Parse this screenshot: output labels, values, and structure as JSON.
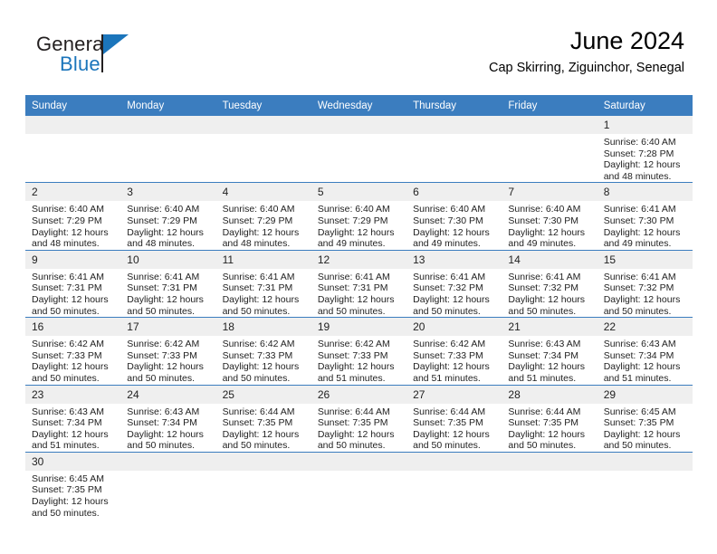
{
  "brand": {
    "name_part1": "General",
    "name_part2": "Blue",
    "flag_icon": "triangle-flag-icon"
  },
  "header": {
    "title": "June 2024",
    "subtitle": "Cap Skirring, Ziguinchor, Senegal"
  },
  "colors": {
    "header_bar": "#3b7dbf",
    "day_band": "#efefef",
    "brand_blue": "#1b75bb",
    "row_divider": "#3b7dbf"
  },
  "weekdays": [
    "Sunday",
    "Monday",
    "Tuesday",
    "Wednesday",
    "Thursday",
    "Friday",
    "Saturday"
  ],
  "weeks": [
    [
      {
        "day": "",
        "blank": true
      },
      {
        "day": "",
        "blank": true
      },
      {
        "day": "",
        "blank": true
      },
      {
        "day": "",
        "blank": true
      },
      {
        "day": "",
        "blank": true
      },
      {
        "day": "",
        "blank": true
      },
      {
        "day": "1",
        "sunrise": "Sunrise: 6:40 AM",
        "sunset": "Sunset: 7:28 PM",
        "daylight_line1": "Daylight: 12 hours",
        "daylight_line2": "and 48 minutes."
      }
    ],
    [
      {
        "day": "2",
        "sunrise": "Sunrise: 6:40 AM",
        "sunset": "Sunset: 7:29 PM",
        "daylight_line1": "Daylight: 12 hours",
        "daylight_line2": "and 48 minutes."
      },
      {
        "day": "3",
        "sunrise": "Sunrise: 6:40 AM",
        "sunset": "Sunset: 7:29 PM",
        "daylight_line1": "Daylight: 12 hours",
        "daylight_line2": "and 48 minutes."
      },
      {
        "day": "4",
        "sunrise": "Sunrise: 6:40 AM",
        "sunset": "Sunset: 7:29 PM",
        "daylight_line1": "Daylight: 12 hours",
        "daylight_line2": "and 48 minutes."
      },
      {
        "day": "5",
        "sunrise": "Sunrise: 6:40 AM",
        "sunset": "Sunset: 7:29 PM",
        "daylight_line1": "Daylight: 12 hours",
        "daylight_line2": "and 49 minutes."
      },
      {
        "day": "6",
        "sunrise": "Sunrise: 6:40 AM",
        "sunset": "Sunset: 7:30 PM",
        "daylight_line1": "Daylight: 12 hours",
        "daylight_line2": "and 49 minutes."
      },
      {
        "day": "7",
        "sunrise": "Sunrise: 6:40 AM",
        "sunset": "Sunset: 7:30 PM",
        "daylight_line1": "Daylight: 12 hours",
        "daylight_line2": "and 49 minutes."
      },
      {
        "day": "8",
        "sunrise": "Sunrise: 6:41 AM",
        "sunset": "Sunset: 7:30 PM",
        "daylight_line1": "Daylight: 12 hours",
        "daylight_line2": "and 49 minutes."
      }
    ],
    [
      {
        "day": "9",
        "sunrise": "Sunrise: 6:41 AM",
        "sunset": "Sunset: 7:31 PM",
        "daylight_line1": "Daylight: 12 hours",
        "daylight_line2": "and 50 minutes."
      },
      {
        "day": "10",
        "sunrise": "Sunrise: 6:41 AM",
        "sunset": "Sunset: 7:31 PM",
        "daylight_line1": "Daylight: 12 hours",
        "daylight_line2": "and 50 minutes."
      },
      {
        "day": "11",
        "sunrise": "Sunrise: 6:41 AM",
        "sunset": "Sunset: 7:31 PM",
        "daylight_line1": "Daylight: 12 hours",
        "daylight_line2": "and 50 minutes."
      },
      {
        "day": "12",
        "sunrise": "Sunrise: 6:41 AM",
        "sunset": "Sunset: 7:31 PM",
        "daylight_line1": "Daylight: 12 hours",
        "daylight_line2": "and 50 minutes."
      },
      {
        "day": "13",
        "sunrise": "Sunrise: 6:41 AM",
        "sunset": "Sunset: 7:32 PM",
        "daylight_line1": "Daylight: 12 hours",
        "daylight_line2": "and 50 minutes."
      },
      {
        "day": "14",
        "sunrise": "Sunrise: 6:41 AM",
        "sunset": "Sunset: 7:32 PM",
        "daylight_line1": "Daylight: 12 hours",
        "daylight_line2": "and 50 minutes."
      },
      {
        "day": "15",
        "sunrise": "Sunrise: 6:41 AM",
        "sunset": "Sunset: 7:32 PM",
        "daylight_line1": "Daylight: 12 hours",
        "daylight_line2": "and 50 minutes."
      }
    ],
    [
      {
        "day": "16",
        "sunrise": "Sunrise: 6:42 AM",
        "sunset": "Sunset: 7:33 PM",
        "daylight_line1": "Daylight: 12 hours",
        "daylight_line2": "and 50 minutes."
      },
      {
        "day": "17",
        "sunrise": "Sunrise: 6:42 AM",
        "sunset": "Sunset: 7:33 PM",
        "daylight_line1": "Daylight: 12 hours",
        "daylight_line2": "and 50 minutes."
      },
      {
        "day": "18",
        "sunrise": "Sunrise: 6:42 AM",
        "sunset": "Sunset: 7:33 PM",
        "daylight_line1": "Daylight: 12 hours",
        "daylight_line2": "and 50 minutes."
      },
      {
        "day": "19",
        "sunrise": "Sunrise: 6:42 AM",
        "sunset": "Sunset: 7:33 PM",
        "daylight_line1": "Daylight: 12 hours",
        "daylight_line2": "and 51 minutes."
      },
      {
        "day": "20",
        "sunrise": "Sunrise: 6:42 AM",
        "sunset": "Sunset: 7:33 PM",
        "daylight_line1": "Daylight: 12 hours",
        "daylight_line2": "and 51 minutes."
      },
      {
        "day": "21",
        "sunrise": "Sunrise: 6:43 AM",
        "sunset": "Sunset: 7:34 PM",
        "daylight_line1": "Daylight: 12 hours",
        "daylight_line2": "and 51 minutes."
      },
      {
        "day": "22",
        "sunrise": "Sunrise: 6:43 AM",
        "sunset": "Sunset: 7:34 PM",
        "daylight_line1": "Daylight: 12 hours",
        "daylight_line2": "and 51 minutes."
      }
    ],
    [
      {
        "day": "23",
        "sunrise": "Sunrise: 6:43 AM",
        "sunset": "Sunset: 7:34 PM",
        "daylight_line1": "Daylight: 12 hours",
        "daylight_line2": "and 51 minutes."
      },
      {
        "day": "24",
        "sunrise": "Sunrise: 6:43 AM",
        "sunset": "Sunset: 7:34 PM",
        "daylight_line1": "Daylight: 12 hours",
        "daylight_line2": "and 50 minutes."
      },
      {
        "day": "25",
        "sunrise": "Sunrise: 6:44 AM",
        "sunset": "Sunset: 7:35 PM",
        "daylight_line1": "Daylight: 12 hours",
        "daylight_line2": "and 50 minutes."
      },
      {
        "day": "26",
        "sunrise": "Sunrise: 6:44 AM",
        "sunset": "Sunset: 7:35 PM",
        "daylight_line1": "Daylight: 12 hours",
        "daylight_line2": "and 50 minutes."
      },
      {
        "day": "27",
        "sunrise": "Sunrise: 6:44 AM",
        "sunset": "Sunset: 7:35 PM",
        "daylight_line1": "Daylight: 12 hours",
        "daylight_line2": "and 50 minutes."
      },
      {
        "day": "28",
        "sunrise": "Sunrise: 6:44 AM",
        "sunset": "Sunset: 7:35 PM",
        "daylight_line1": "Daylight: 12 hours",
        "daylight_line2": "and 50 minutes."
      },
      {
        "day": "29",
        "sunrise": "Sunrise: 6:45 AM",
        "sunset": "Sunset: 7:35 PM",
        "daylight_line1": "Daylight: 12 hours",
        "daylight_line2": "and 50 minutes."
      }
    ],
    [
      {
        "day": "30",
        "sunrise": "Sunrise: 6:45 AM",
        "sunset": "Sunset: 7:35 PM",
        "daylight_line1": "Daylight: 12 hours",
        "daylight_line2": "and 50 minutes."
      },
      {
        "day": "",
        "blank": true
      },
      {
        "day": "",
        "blank": true
      },
      {
        "day": "",
        "blank": true
      },
      {
        "day": "",
        "blank": true
      },
      {
        "day": "",
        "blank": true
      },
      {
        "day": "",
        "blank": true
      }
    ]
  ]
}
